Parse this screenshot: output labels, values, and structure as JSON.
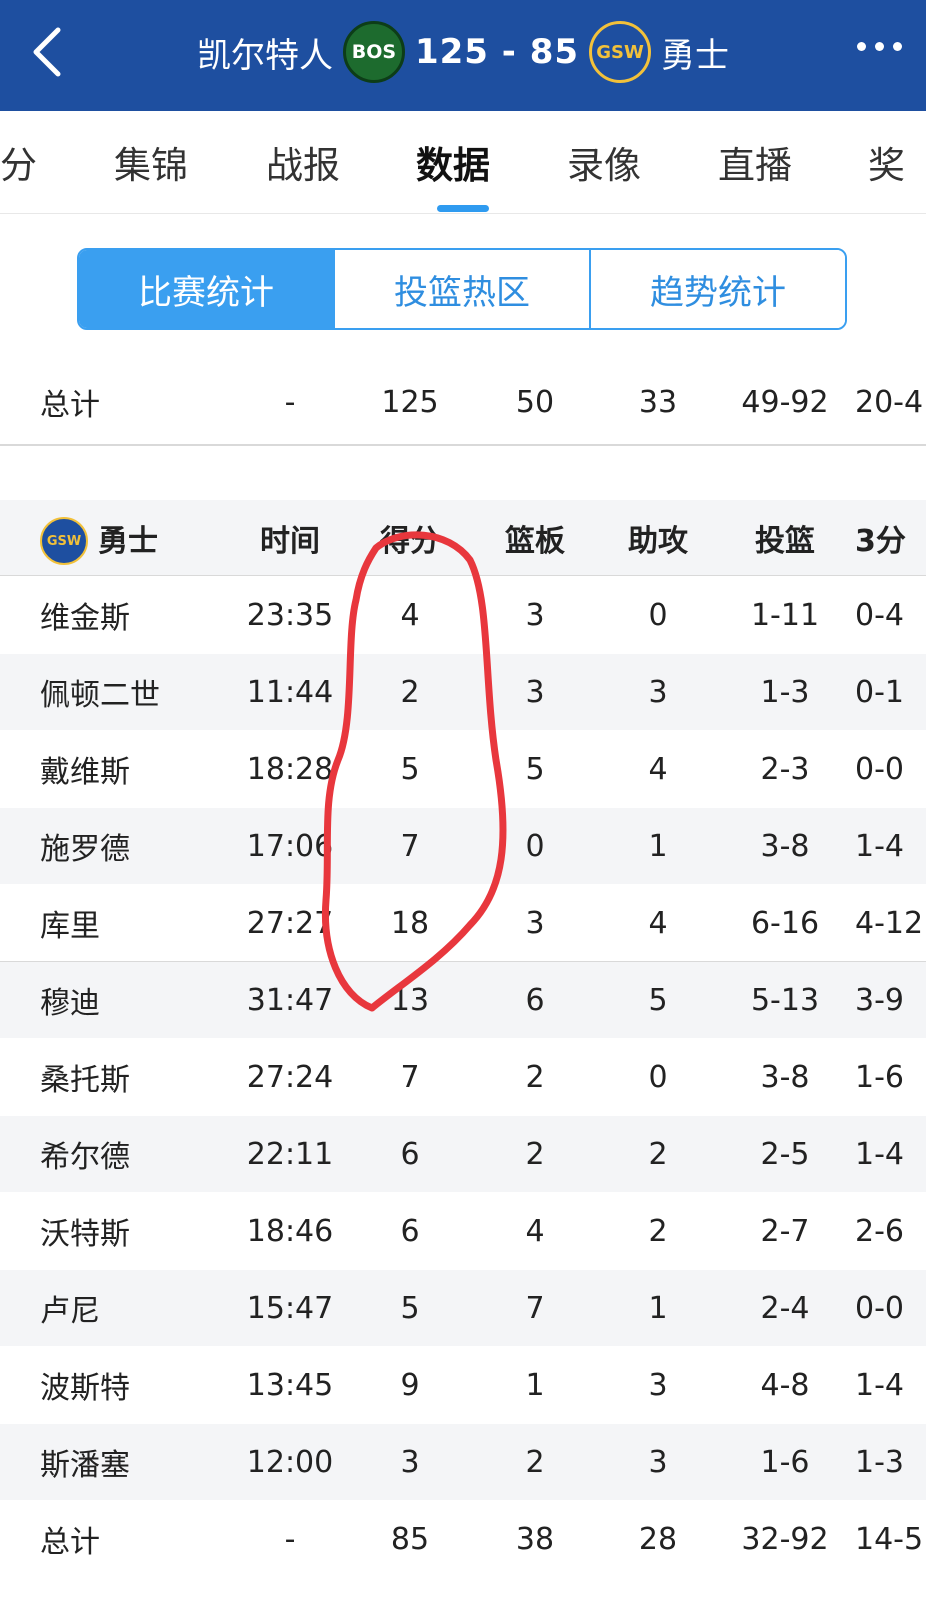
{
  "header": {
    "home_team": "凯尔特人",
    "home_logo_text": "BOS",
    "score": "125 - 85",
    "away_logo_text": "GSW",
    "away_team": "勇士"
  },
  "tabs": [
    "分",
    "集锦",
    "战报",
    "数据",
    "录像",
    "直播",
    "奖"
  ],
  "segments": [
    "比赛统计",
    "投篮热区",
    "趋势统计"
  ],
  "celtics_total": {
    "label": "总计",
    "time": "-",
    "pts": "125",
    "reb": "50",
    "ast": "33",
    "fg": "49-92",
    "three": "20-4"
  },
  "warriors": {
    "team": "勇士",
    "logo_text": "GSW",
    "columns": [
      "时间",
      "得分",
      "篮板",
      "助攻",
      "投篮",
      "3分"
    ],
    "players": [
      {
        "name": "维金斯",
        "time": "23:35",
        "pts": "4",
        "reb": "3",
        "ast": "0",
        "fg": "1-11",
        "three": "0-4"
      },
      {
        "name": "佩顿二世",
        "time": "11:44",
        "pts": "2",
        "reb": "3",
        "ast": "3",
        "fg": "1-3",
        "three": "0-1"
      },
      {
        "name": "戴维斯",
        "time": "18:28",
        "pts": "5",
        "reb": "5",
        "ast": "4",
        "fg": "2-3",
        "three": "0-0"
      },
      {
        "name": "施罗德",
        "time": "17:06",
        "pts": "7",
        "reb": "0",
        "ast": "1",
        "fg": "3-8",
        "three": "1-4"
      },
      {
        "name": "库里",
        "time": "27:27",
        "pts": "18",
        "reb": "3",
        "ast": "4",
        "fg": "6-16",
        "three": "4-12"
      },
      {
        "name": "穆迪",
        "time": "31:47",
        "pts": "13",
        "reb": "6",
        "ast": "5",
        "fg": "5-13",
        "three": "3-9"
      },
      {
        "name": "桑托斯",
        "time": "27:24",
        "pts": "7",
        "reb": "2",
        "ast": "0",
        "fg": "3-8",
        "three": "1-6"
      },
      {
        "name": "希尔德",
        "time": "22:11",
        "pts": "6",
        "reb": "2",
        "ast": "2",
        "fg": "2-5",
        "three": "1-4"
      },
      {
        "name": "沃特斯",
        "time": "18:46",
        "pts": "6",
        "reb": "4",
        "ast": "2",
        "fg": "2-7",
        "three": "2-6"
      },
      {
        "name": "卢尼",
        "time": "15:47",
        "pts": "5",
        "reb": "7",
        "ast": "1",
        "fg": "2-4",
        "three": "0-0"
      },
      {
        "name": "波斯特",
        "time": "13:45",
        "pts": "9",
        "reb": "1",
        "ast": "3",
        "fg": "4-8",
        "three": "1-4"
      },
      {
        "name": "斯潘塞",
        "time": "12:00",
        "pts": "3",
        "reb": "2",
        "ast": "3",
        "fg": "1-6",
        "three": "1-3"
      }
    ],
    "total": {
      "label": "总计",
      "time": "-",
      "pts": "85",
      "reb": "38",
      "ast": "28",
      "fg": "32-92",
      "three": "14-5"
    }
  },
  "colors": {
    "header_bg": "#1e4fa0",
    "accent": "#3a9ff0",
    "annotation": "#e8373d"
  }
}
